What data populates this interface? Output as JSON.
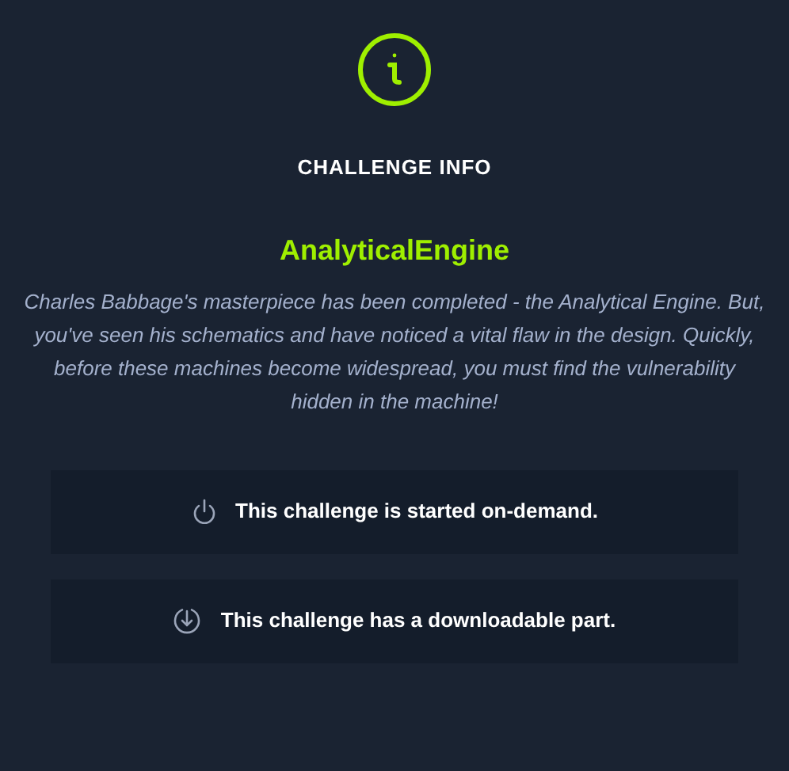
{
  "heading": "CHALLENGE INFO",
  "challenge": {
    "name": "AnalyticalEngine",
    "description": "Charles Babbage's masterpiece has been completed - the Analytical Engine. But, you've seen his schematics and have noticed a vital flaw in the design. Quickly, before these machines become widespread, you must find the vulnerability hidden in the machine!"
  },
  "features": [
    {
      "kind": "power",
      "text": "This challenge is started on-demand."
    },
    {
      "kind": "download",
      "text": "This challenge has a downloadable part."
    }
  ]
}
